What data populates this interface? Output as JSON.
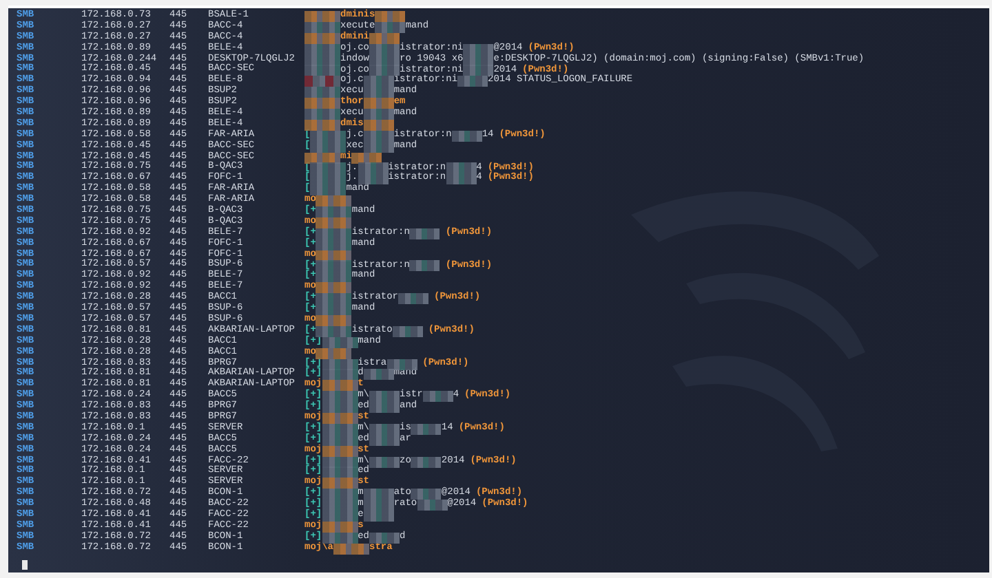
{
  "lines": [
    {
      "protocol": "SMB",
      "ip": "172.168.0.73",
      "port": "445",
      "host": "BSALE-1",
      "parts": [
        {
          "kind": "redacted"
        },
        {
          "kind": "admin",
          "text": "dminis"
        },
        {
          "kind": "redacted"
        }
      ]
    },
    {
      "protocol": "SMB",
      "ip": "172.168.0.27",
      "port": "445",
      "host": "BACC-4",
      "parts": [
        {
          "kind": "redacted"
        },
        {
          "kind": "text",
          "text": "xecute"
        },
        {
          "kind": "redacted"
        },
        {
          "kind": "text",
          "text": "mand"
        }
      ]
    },
    {
      "protocol": "SMB",
      "ip": "172.168.0.27",
      "port": "445",
      "host": "BACC-4",
      "parts": [
        {
          "kind": "redacted"
        },
        {
          "kind": "admin",
          "text": "dmini"
        },
        {
          "kind": "redacted"
        }
      ]
    },
    {
      "protocol": "SMB",
      "ip": "172.168.0.89",
      "port": "445",
      "host": "BELE-4",
      "parts": [
        {
          "kind": "redacted"
        },
        {
          "kind": "text",
          "text": "oj.co"
        },
        {
          "kind": "redacted"
        },
        {
          "kind": "text",
          "text": "istrator:ni"
        },
        {
          "kind": "redacted"
        },
        {
          "kind": "text",
          "text": "@2014"
        },
        {
          "kind": "pwned",
          "text": "(Pwn3d!)"
        }
      ]
    },
    {
      "protocol": "SMB",
      "ip": "172.168.0.244",
      "port": "445",
      "host": "DESKTOP-7LQGLJ2",
      "parts": [
        {
          "kind": "redacted"
        },
        {
          "kind": "text",
          "text": "indow"
        },
        {
          "kind": "redacted"
        },
        {
          "kind": "text",
          "text": "ro 19043 x6"
        },
        {
          "kind": "redacted"
        },
        {
          "kind": "text",
          "text": "e:DESKTOP-7LQGLJ2) (domain:moj.com) (signing:False) (SMBv1:True)"
        }
      ]
    },
    {
      "protocol": "SMB",
      "ip": "172.168.0.45",
      "port": "445",
      "host": "BACC-SEC",
      "parts": [
        {
          "kind": "redacted"
        },
        {
          "kind": "text",
          "text": "oj.co"
        },
        {
          "kind": "redacted"
        },
        {
          "kind": "text",
          "text": "istrator:ni"
        },
        {
          "kind": "redacted"
        },
        {
          "kind": "text",
          "text": "2014"
        },
        {
          "kind": "pwned",
          "text": "(Pwn3d!)"
        }
      ]
    },
    {
      "protocol": "SMB",
      "ip": "172.168.0.94",
      "port": "445",
      "host": "BELE-8",
      "parts": [
        {
          "kind": "failed"
        },
        {
          "kind": "text",
          "text": "oj.c"
        },
        {
          "kind": "redacted"
        },
        {
          "kind": "text",
          "text": "istrator:ni"
        },
        {
          "kind": "redacted"
        },
        {
          "kind": "text",
          "text": "2014 STATUS_LOGON_FAILURE"
        }
      ]
    },
    {
      "protocol": "SMB",
      "ip": "172.168.0.96",
      "port": "445",
      "host": "BSUP2",
      "parts": [
        {
          "kind": "redacted"
        },
        {
          "kind": "text",
          "text": "xecu"
        },
        {
          "kind": "redacted"
        },
        {
          "kind": "text",
          "text": "mand"
        }
      ]
    },
    {
      "protocol": "SMB",
      "ip": "172.168.0.96",
      "port": "445",
      "host": "BSUP2",
      "parts": [
        {
          "kind": "redacted"
        },
        {
          "kind": "admin",
          "text": "thor"
        },
        {
          "kind": "redacted"
        },
        {
          "kind": "admin",
          "text": "em"
        }
      ]
    },
    {
      "protocol": "SMB",
      "ip": "172.168.0.89",
      "port": "445",
      "host": "BELE-4",
      "parts": [
        {
          "kind": "redacted"
        },
        {
          "kind": "text",
          "text": "xecu"
        },
        {
          "kind": "redacted"
        },
        {
          "kind": "text",
          "text": "mand"
        }
      ]
    },
    {
      "protocol": "SMB",
      "ip": "172.168.0.89",
      "port": "445",
      "host": "BELE-4",
      "parts": [
        {
          "kind": "redacted"
        },
        {
          "kind": "admin",
          "text": "dmis"
        },
        {
          "kind": "redacted"
        }
      ]
    },
    {
      "protocol": "SMB",
      "ip": "172.168.0.58",
      "port": "445",
      "host": "FAR-ARIA",
      "parts": [
        {
          "kind": "marker",
          "text": "["
        },
        {
          "kind": "redacted"
        },
        {
          "kind": "text",
          "text": "j.c"
        },
        {
          "kind": "redacted"
        },
        {
          "kind": "text",
          "text": "istrator:n"
        },
        {
          "kind": "redacted"
        },
        {
          "kind": "text",
          "text": "14"
        },
        {
          "kind": "pwned",
          "text": "(Pwn3d!)"
        }
      ]
    },
    {
      "protocol": "SMB",
      "ip": "172.168.0.45",
      "port": "445",
      "host": "BACC-SEC",
      "parts": [
        {
          "kind": "marker",
          "text": "["
        },
        {
          "kind": "redacted"
        },
        {
          "kind": "text",
          "text": "xec"
        },
        {
          "kind": "redacted"
        },
        {
          "kind": "text",
          "text": "mand"
        }
      ]
    },
    {
      "protocol": "SMB",
      "ip": "172.168.0.45",
      "port": "445",
      "host": "BACC-SEC",
      "parts": [
        {
          "kind": "redacted"
        },
        {
          "kind": "admin",
          "text": "mi"
        },
        {
          "kind": "redacted"
        }
      ]
    },
    {
      "protocol": "SMB",
      "ip": "172.168.0.75",
      "port": "445",
      "host": "B-QAC3",
      "parts": [
        {
          "kind": "marker",
          "text": "["
        },
        {
          "kind": "redacted"
        },
        {
          "kind": "text",
          "text": "j."
        },
        {
          "kind": "redacted"
        },
        {
          "kind": "text",
          "text": "istrator:n"
        },
        {
          "kind": "redacted"
        },
        {
          "kind": "text",
          "text": "4"
        },
        {
          "kind": "pwned",
          "text": "(Pwn3d!)"
        }
      ]
    },
    {
      "protocol": "SMB",
      "ip": "172.168.0.67",
      "port": "445",
      "host": "FOFC-1",
      "parts": [
        {
          "kind": "marker",
          "text": "["
        },
        {
          "kind": "redacted"
        },
        {
          "kind": "text",
          "text": "j."
        },
        {
          "kind": "redacted"
        },
        {
          "kind": "text",
          "text": "istrator:n"
        },
        {
          "kind": "redacted"
        },
        {
          "kind": "text",
          "text": "4"
        },
        {
          "kind": "pwned",
          "text": "(Pwn3d!)"
        }
      ]
    },
    {
      "protocol": "SMB",
      "ip": "172.168.0.58",
      "port": "445",
      "host": "FAR-ARIA",
      "parts": [
        {
          "kind": "marker",
          "text": "["
        },
        {
          "kind": "redacted"
        },
        {
          "kind": "text",
          "text": "mand"
        }
      ]
    },
    {
      "protocol": "SMB",
      "ip": "172.168.0.58",
      "port": "445",
      "host": "FAR-ARIA",
      "parts": [
        {
          "kind": "admin",
          "text": "mo"
        },
        {
          "kind": "redacted"
        }
      ]
    },
    {
      "protocol": "SMB",
      "ip": "172.168.0.75",
      "port": "445",
      "host": "B-QAC3",
      "parts": [
        {
          "kind": "marker",
          "text": "[+"
        },
        {
          "kind": "redacted"
        },
        {
          "kind": "text",
          "text": "mand"
        }
      ]
    },
    {
      "protocol": "SMB",
      "ip": "172.168.0.75",
      "port": "445",
      "host": "B-QAC3",
      "parts": [
        {
          "kind": "admin",
          "text": "mo"
        },
        {
          "kind": "redacted"
        }
      ]
    },
    {
      "protocol": "SMB",
      "ip": "172.168.0.92",
      "port": "445",
      "host": "BELE-7",
      "parts": [
        {
          "kind": "marker",
          "text": "[+"
        },
        {
          "kind": "redacted"
        },
        {
          "kind": "text",
          "text": "istrator:n"
        },
        {
          "kind": "redacted"
        },
        {
          "kind": "pwned",
          "text": "(Pwn3d!)"
        }
      ]
    },
    {
      "protocol": "SMB",
      "ip": "172.168.0.67",
      "port": "445",
      "host": "FOFC-1",
      "parts": [
        {
          "kind": "marker",
          "text": "[+"
        },
        {
          "kind": "redacted"
        },
        {
          "kind": "text",
          "text": "mand"
        }
      ]
    },
    {
      "protocol": "SMB",
      "ip": "172.168.0.67",
      "port": "445",
      "host": "FOFC-1",
      "parts": [
        {
          "kind": "admin",
          "text": "mo"
        },
        {
          "kind": "redacted"
        }
      ]
    },
    {
      "protocol": "SMB",
      "ip": "172.168.0.57",
      "port": "445",
      "host": "BSUP-6",
      "parts": [
        {
          "kind": "marker",
          "text": "[+"
        },
        {
          "kind": "redacted"
        },
        {
          "kind": "text",
          "text": "istrator:n"
        },
        {
          "kind": "redacted"
        },
        {
          "kind": "pwned",
          "text": "(Pwn3d!)"
        }
      ]
    },
    {
      "protocol": "SMB",
      "ip": "172.168.0.92",
      "port": "445",
      "host": "BELE-7",
      "parts": [
        {
          "kind": "marker",
          "text": "[+"
        },
        {
          "kind": "redacted"
        },
        {
          "kind": "text",
          "text": "mand"
        }
      ]
    },
    {
      "protocol": "SMB",
      "ip": "172.168.0.92",
      "port": "445",
      "host": "BELE-7",
      "parts": [
        {
          "kind": "admin",
          "text": "mo"
        },
        {
          "kind": "redacted"
        }
      ]
    },
    {
      "protocol": "SMB",
      "ip": "172.168.0.28",
      "port": "445",
      "host": "BACC1",
      "parts": [
        {
          "kind": "marker",
          "text": "[+"
        },
        {
          "kind": "redacted"
        },
        {
          "kind": "text",
          "text": "istrator"
        },
        {
          "kind": "redacted"
        },
        {
          "kind": "pwned",
          "text": "(Pwn3d!)"
        }
      ]
    },
    {
      "protocol": "SMB",
      "ip": "172.168.0.57",
      "port": "445",
      "host": "BSUP-6",
      "parts": [
        {
          "kind": "marker",
          "text": "[+"
        },
        {
          "kind": "redacted"
        },
        {
          "kind": "text",
          "text": "mand"
        }
      ]
    },
    {
      "protocol": "SMB",
      "ip": "172.168.0.57",
      "port": "445",
      "host": "BSUP-6",
      "parts": [
        {
          "kind": "admin",
          "text": "mo"
        },
        {
          "kind": "redacted"
        }
      ]
    },
    {
      "protocol": "SMB",
      "ip": "172.168.0.81",
      "port": "445",
      "host": "AKBARIAN-LAPTOP",
      "parts": [
        {
          "kind": "marker",
          "text": "[+"
        },
        {
          "kind": "redacted"
        },
        {
          "kind": "text",
          "text": "istrato"
        },
        {
          "kind": "redacted"
        },
        {
          "kind": "pwned",
          "text": "(Pwn3d!)"
        }
      ]
    },
    {
      "protocol": "SMB",
      "ip": "172.168.0.28",
      "port": "445",
      "host": "BACC1",
      "parts": [
        {
          "kind": "marker",
          "text": "[+]"
        },
        {
          "kind": "redacted"
        },
        {
          "kind": "text",
          "text": "mand"
        }
      ]
    },
    {
      "protocol": "SMB",
      "ip": "172.168.0.28",
      "port": "445",
      "host": "BACC1",
      "parts": [
        {
          "kind": "admin",
          "text": "mo"
        },
        {
          "kind": "redacted"
        }
      ]
    },
    {
      "protocol": "SMB",
      "ip": "172.168.0.83",
      "port": "445",
      "host": "BPRG7",
      "parts": [
        {
          "kind": "marker",
          "text": "[+]"
        },
        {
          "kind": "redacted"
        },
        {
          "kind": "text",
          "text": "istra"
        },
        {
          "kind": "redacted"
        },
        {
          "kind": "pwned",
          "text": "(Pwn3d!)"
        }
      ]
    },
    {
      "protocol": "SMB",
      "ip": "172.168.0.81",
      "port": "445",
      "host": "AKBARIAN-LAPTOP",
      "parts": [
        {
          "kind": "marker",
          "text": "[+]"
        },
        {
          "kind": "redacted"
        },
        {
          "kind": "text",
          "text": "d"
        },
        {
          "kind": "redacted"
        },
        {
          "kind": "text",
          "text": "mand"
        }
      ]
    },
    {
      "protocol": "SMB",
      "ip": "172.168.0.81",
      "port": "445",
      "host": "AKBARIAN-LAPTOP",
      "parts": [
        {
          "kind": "admin",
          "text": "moj"
        },
        {
          "kind": "redacted"
        },
        {
          "kind": "admin",
          "text": "t"
        }
      ]
    },
    {
      "protocol": "SMB",
      "ip": "172.168.0.24",
      "port": "445",
      "host": "BACC5",
      "parts": [
        {
          "kind": "marker",
          "text": "[+]"
        },
        {
          "kind": "redacted"
        },
        {
          "kind": "text",
          "text": "m\\"
        },
        {
          "kind": "redacted"
        },
        {
          "kind": "text",
          "text": "istr"
        },
        {
          "kind": "redacted"
        },
        {
          "kind": "text",
          "text": "4"
        },
        {
          "kind": "pwned",
          "text": "(Pwn3d!)"
        }
      ]
    },
    {
      "protocol": "SMB",
      "ip": "172.168.0.83",
      "port": "445",
      "host": "BPRG7",
      "parts": [
        {
          "kind": "marker",
          "text": "[+]"
        },
        {
          "kind": "redacted"
        },
        {
          "kind": "text",
          "text": "ed"
        },
        {
          "kind": "redacted"
        },
        {
          "kind": "text",
          "text": "and"
        }
      ]
    },
    {
      "protocol": "SMB",
      "ip": "172.168.0.83",
      "port": "445",
      "host": "BPRG7",
      "parts": [
        {
          "kind": "admin",
          "text": "moj"
        },
        {
          "kind": "redacted"
        },
        {
          "kind": "admin",
          "text": "st"
        }
      ]
    },
    {
      "protocol": "SMB",
      "ip": "172.168.0.1",
      "port": "445",
      "host": "SERVER",
      "parts": [
        {
          "kind": "marker",
          "text": "[+]"
        },
        {
          "kind": "redacted"
        },
        {
          "kind": "text",
          "text": "m\\"
        },
        {
          "kind": "redacted"
        },
        {
          "kind": "text",
          "text": "is"
        },
        {
          "kind": "redacted"
        },
        {
          "kind": "text",
          "text": "14"
        },
        {
          "kind": "pwned",
          "text": "(Pwn3d!)"
        }
      ]
    },
    {
      "protocol": "SMB",
      "ip": "172.168.0.24",
      "port": "445",
      "host": "BACC5",
      "parts": [
        {
          "kind": "marker",
          "text": "[+]"
        },
        {
          "kind": "redacted"
        },
        {
          "kind": "text",
          "text": "ed"
        },
        {
          "kind": "redacted"
        },
        {
          "kind": "text",
          "text": "ar"
        }
      ]
    },
    {
      "protocol": "SMB",
      "ip": "172.168.0.24",
      "port": "445",
      "host": "BACC5",
      "parts": [
        {
          "kind": "admin",
          "text": "moj"
        },
        {
          "kind": "redacted"
        },
        {
          "kind": "admin",
          "text": "st"
        }
      ]
    },
    {
      "protocol": "SMB",
      "ip": "172.168.0.41",
      "port": "445",
      "host": "FACC-22",
      "parts": [
        {
          "kind": "marker",
          "text": "[+]"
        },
        {
          "kind": "redacted"
        },
        {
          "kind": "text",
          "text": "m\\"
        },
        {
          "kind": "redacted"
        },
        {
          "kind": "text",
          "text": "zo"
        },
        {
          "kind": "redacted"
        },
        {
          "kind": "text",
          "text": "2014"
        },
        {
          "kind": "pwned",
          "text": "(Pwn3d!)"
        }
      ]
    },
    {
      "protocol": "SMB",
      "ip": "172.168.0.1",
      "port": "445",
      "host": "SERVER",
      "parts": [
        {
          "kind": "marker",
          "text": "[+]"
        },
        {
          "kind": "redacted"
        },
        {
          "kind": "text",
          "text": "ed"
        }
      ]
    },
    {
      "protocol": "SMB",
      "ip": "172.168.0.1",
      "port": "445",
      "host": "SERVER",
      "parts": [
        {
          "kind": "admin",
          "text": "moj"
        },
        {
          "kind": "redacted"
        },
        {
          "kind": "admin",
          "text": "st"
        }
      ]
    },
    {
      "protocol": "SMB",
      "ip": "172.168.0.72",
      "port": "445",
      "host": "BCON-1",
      "parts": [
        {
          "kind": "marker",
          "text": "[+]"
        },
        {
          "kind": "redacted"
        },
        {
          "kind": "text",
          "text": "m"
        },
        {
          "kind": "redacted"
        },
        {
          "kind": "text",
          "text": "ato"
        },
        {
          "kind": "redacted"
        },
        {
          "kind": "text",
          "text": "@2014"
        },
        {
          "kind": "pwned",
          "text": "(Pwn3d!)"
        }
      ]
    },
    {
      "protocol": "SMB",
      "ip": "172.168.0.48",
      "port": "445",
      "host": "BACC-22",
      "parts": [
        {
          "kind": "marker",
          "text": "[+]"
        },
        {
          "kind": "redacted"
        },
        {
          "kind": "text",
          "text": "m"
        },
        {
          "kind": "redacted"
        },
        {
          "kind": "text",
          "text": "rato"
        },
        {
          "kind": "redacted"
        },
        {
          "kind": "text",
          "text": "@2014"
        },
        {
          "kind": "pwned",
          "text": "(Pwn3d!)"
        }
      ]
    },
    {
      "protocol": "SMB",
      "ip": "172.168.0.41",
      "port": "445",
      "host": "FACC-22",
      "parts": [
        {
          "kind": "marker",
          "text": "[+]"
        },
        {
          "kind": "redacted"
        },
        {
          "kind": "text",
          "text": "e"
        },
        {
          "kind": "redacted"
        }
      ]
    },
    {
      "protocol": "SMB",
      "ip": "172.168.0.41",
      "port": "445",
      "host": "FACC-22",
      "parts": [
        {
          "kind": "admin",
          "text": "moj"
        },
        {
          "kind": "redacted"
        },
        {
          "kind": "admin",
          "text": "s"
        }
      ]
    },
    {
      "protocol": "SMB",
      "ip": "172.168.0.72",
      "port": "445",
      "host": "BCON-1",
      "parts": [
        {
          "kind": "marker",
          "text": "[+]"
        },
        {
          "kind": "redacted"
        },
        {
          "kind": "text",
          "text": "ed"
        },
        {
          "kind": "redacted"
        },
        {
          "kind": "text",
          "text": "d"
        }
      ]
    },
    {
      "protocol": "SMB",
      "ip": "172.168.0.72",
      "port": "445",
      "host": "BCON-1",
      "parts": [
        {
          "kind": "admin",
          "text": "moj\\a"
        },
        {
          "kind": "redacted"
        },
        {
          "kind": "admin",
          "text": "stra"
        }
      ]
    }
  ]
}
